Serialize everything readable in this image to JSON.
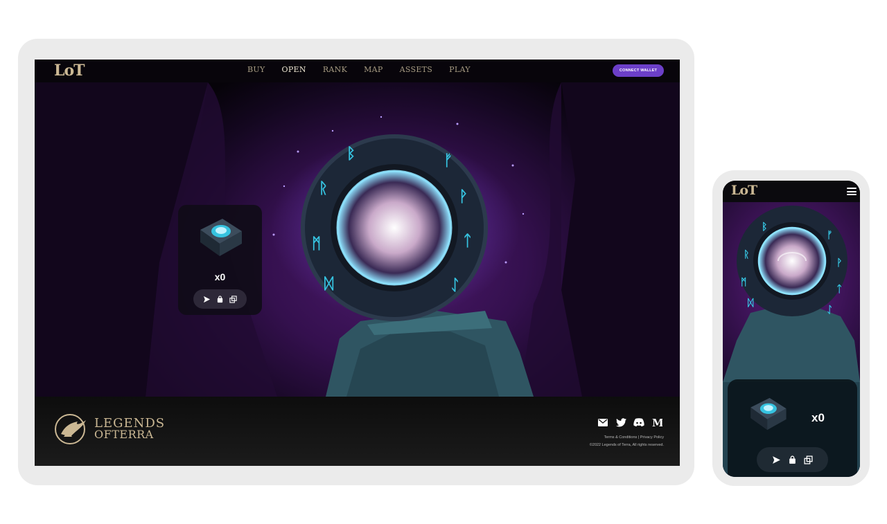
{
  "brand": {
    "logo_text": "LoT",
    "name_line1": "LEGENDS",
    "name_line2": "OFTERRA"
  },
  "nav": {
    "links": [
      {
        "label": "BUY",
        "active": false
      },
      {
        "label": "OPEN",
        "active": true
      },
      {
        "label": "RANK",
        "active": false
      },
      {
        "label": "MAP",
        "active": false
      },
      {
        "label": "ASSETS",
        "active": false
      },
      {
        "label": "PLAY",
        "active": false
      }
    ],
    "connect_label": "CONNECT WALLET"
  },
  "chest": {
    "count_label": "x0",
    "actions": [
      "send-icon",
      "bag-icon",
      "copy-icon"
    ]
  },
  "footer": {
    "socials": [
      "mail-icon",
      "twitter-icon",
      "discord-icon",
      "medium-icon"
    ],
    "terms": "Terms & Conditions",
    "separator": "|",
    "privacy": "Privacy Policy",
    "copyright": "©2022 Legends of Terra, All rights reserved."
  },
  "mobile": {
    "logo_text": "LoT",
    "count_label": "x0"
  },
  "colors": {
    "accent": "#6c3fc8",
    "gold": "#cbb894",
    "rune": "#36c3e0",
    "portal_glow": "#8fe3ff"
  }
}
